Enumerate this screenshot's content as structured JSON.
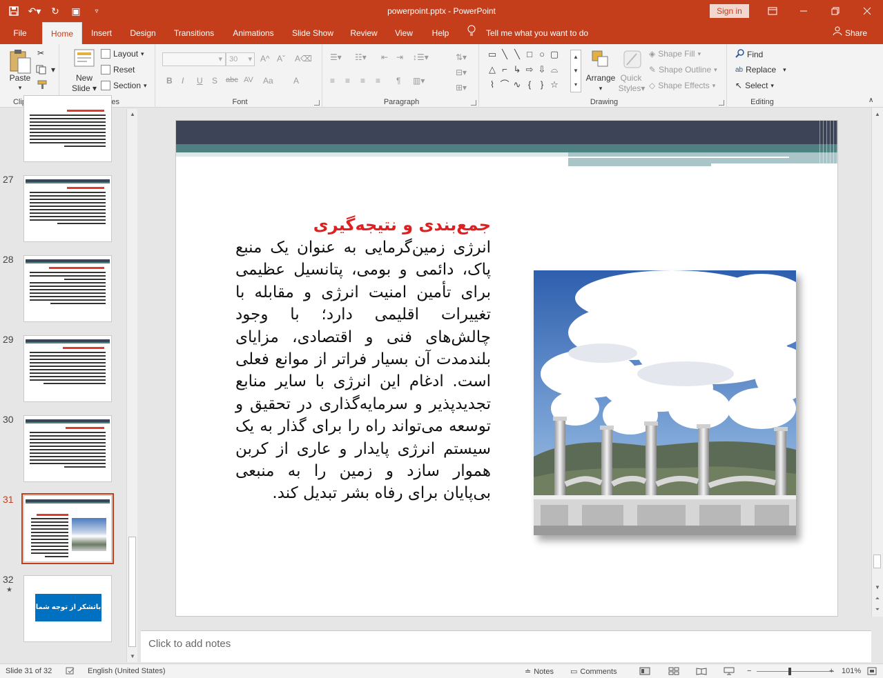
{
  "window": {
    "title": "powerpoint.pptx  -  PowerPoint",
    "signin_label": "Sign in",
    "accent": "#c43e1c"
  },
  "tabs": [
    "File",
    "Home",
    "Insert",
    "Design",
    "Transitions",
    "Animations",
    "Slide Show",
    "Review",
    "View",
    "Help"
  ],
  "active_tab": "Home",
  "tellme": "Tell me what you want to do",
  "share_label": "Share",
  "ribbon": {
    "clipboard": {
      "label": "Clipboard",
      "paste": "Paste"
    },
    "slides": {
      "label": "Slides",
      "new_slide_1": "New",
      "new_slide_2": "Slide",
      "layout": "Layout",
      "reset": "Reset",
      "section": "Section"
    },
    "font": {
      "label": "Font",
      "size_value": "30",
      "bold": "B",
      "italic": "I",
      "underline": "U",
      "shadow": "S",
      "strike": "abc",
      "spacing": "AV",
      "case": "Aa",
      "color": "A"
    },
    "paragraph": {
      "label": "Paragraph"
    },
    "drawing": {
      "label": "Drawing",
      "arrange": "Arrange",
      "quick_styles_1": "Quick",
      "quick_styles_2": "Styles",
      "shape_fill": "Shape Fill",
      "shape_outline": "Shape Outline",
      "shape_effects": "Shape Effects"
    },
    "editing": {
      "label": "Editing",
      "find": "Find",
      "replace": "Replace",
      "select": "Select"
    }
  },
  "thumbnails": [
    {
      "num": "",
      "kind": "text"
    },
    {
      "num": "27",
      "kind": "text"
    },
    {
      "num": "28",
      "kind": "text"
    },
    {
      "num": "29",
      "kind": "text"
    },
    {
      "num": "30",
      "kind": "text"
    },
    {
      "num": "31",
      "kind": "image"
    },
    {
      "num": "32",
      "kind": "thanks"
    }
  ],
  "thumb_thanks_text": "باتشکر از توجه شما",
  "slide": {
    "title": "جمع‌بندی و نتیجه‌گیری",
    "body": "انرژی زمین‌گرمایی به عنوان یک منبع پاک، دائمی و بومی، پتانسیل عظیمی برای تأمین امنیت انرژی و مقابله با تغییرات اقلیمی دارد؛ با وجود چالش‌های فنی و اقتصادی، مزایای بلندمدت آن بسیار فراتر از موانع فعلی است. ادغام این انرژی با سایر منابع تجدیدپذیر و سرمایه‌گذاری در تحقیق و توسعه می‌تواند راه را برای گذار به یک سیستم انرژی پایدار و عاری از کربن هموار سازد و زمین را به منبعی بی‌پایان برای رفاه بشر تبدیل کند.",
    "title_color": "#e02020",
    "band_dark": "#3e4457",
    "band_teal": "#4f8183"
  },
  "notes_placeholder": "Click to add notes",
  "status": {
    "slide_info": "Slide 31 of 32",
    "language": "English (United States)",
    "notes": "Notes",
    "comments": "Comments",
    "zoom": "101%",
    "minus": "−",
    "plus": "+"
  }
}
